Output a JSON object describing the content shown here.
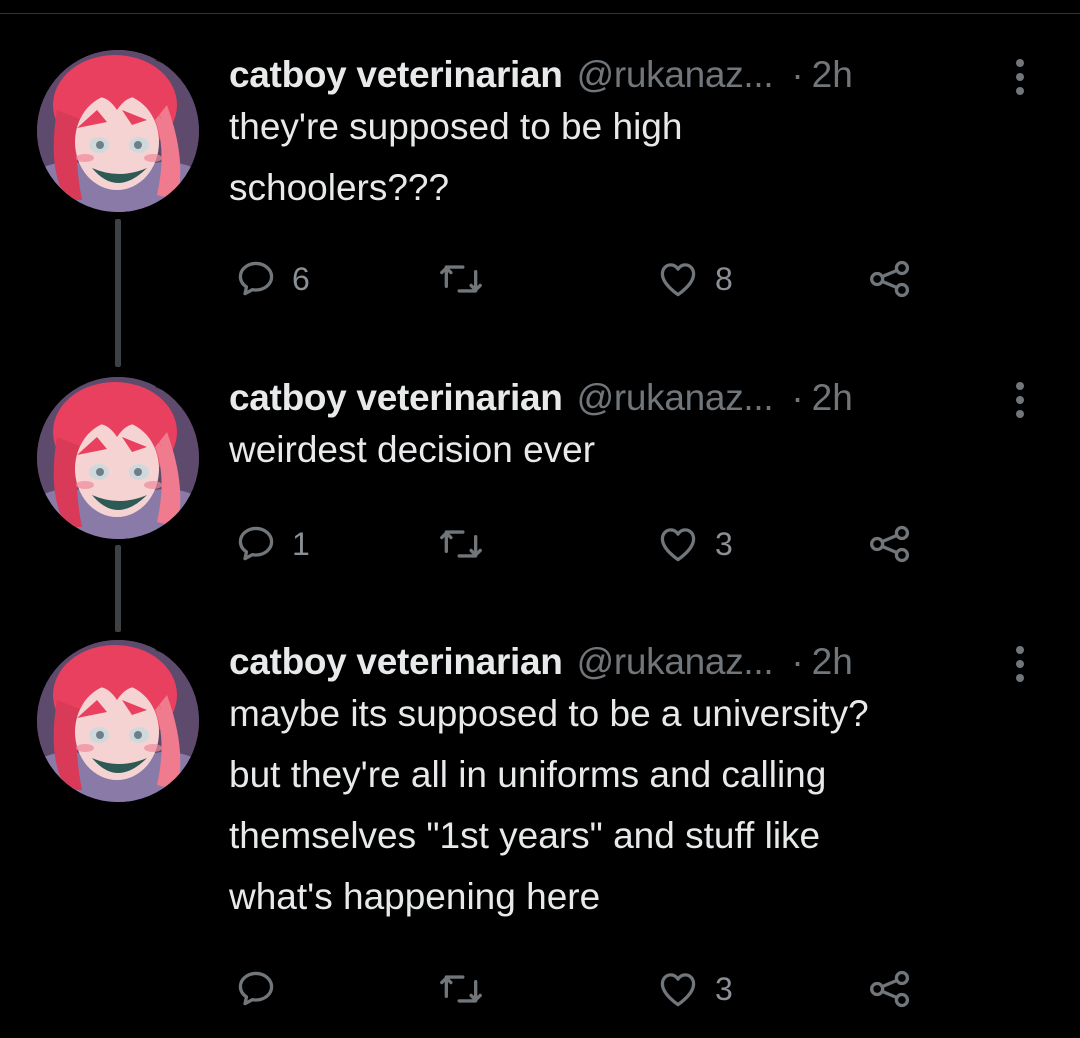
{
  "tweets": [
    {
      "name": "catboy veterinarian",
      "handle": "@rukanaz...",
      "dot": "·",
      "time": "2h",
      "text": "they're supposed to be high\nschoolers???",
      "replies": "6",
      "retweets": "",
      "likes": "8"
    },
    {
      "name": "catboy veterinarian",
      "handle": "@rukanaz...",
      "dot": "·",
      "time": "2h",
      "text": "weirdest decision ever",
      "replies": "1",
      "retweets": "",
      "likes": "3"
    },
    {
      "name": "catboy veterinarian",
      "handle": "@rukanaz...",
      "dot": "·",
      "time": "2h",
      "text": "maybe its supposed to be a university?\nbut they're all in uniforms and calling\nthemselves \"1st years\" and stuff like\nwhat's happening here",
      "replies": "",
      "retweets": "",
      "likes": "3"
    }
  ],
  "colors": {
    "background": "#000000",
    "text_primary": "#e7e9ea",
    "text_secondary": "#71767b",
    "thread_line": "#3e4144",
    "avatar_hair": "#e8405e"
  },
  "icons": {
    "reply": "speech-bubble-icon",
    "retweet": "retweet-arrows-icon",
    "like": "heart-outline-icon",
    "share": "share-nodes-icon",
    "more": "vertical-ellipsis-icon"
  }
}
